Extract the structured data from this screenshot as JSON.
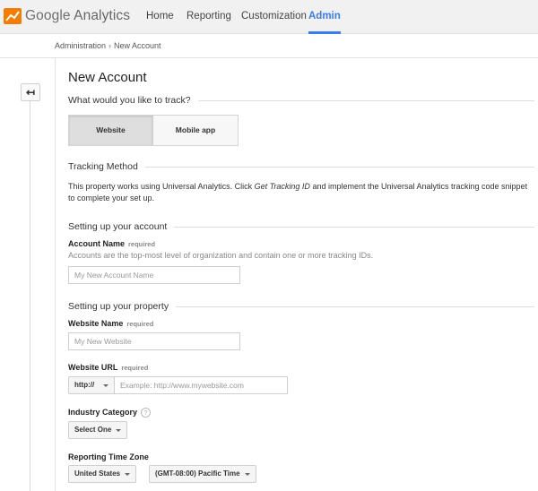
{
  "app": {
    "logo_google": "Google",
    "logo_product": "Analytics"
  },
  "nav": {
    "items": [
      {
        "label": "Home"
      },
      {
        "label": "Reporting"
      },
      {
        "label": "Customization"
      },
      {
        "label": "Admin",
        "active": true
      }
    ]
  },
  "breadcrumb": {
    "items": [
      "Administration",
      "New Account"
    ],
    "separator": "›"
  },
  "back_button": {
    "glyph": "↤",
    "icon": "back-arrow-icon"
  },
  "page": {
    "title": "New Account",
    "track_question": "What would you like to track?",
    "track_options": [
      {
        "label": "Website",
        "selected": true
      },
      {
        "label": "Mobile app",
        "selected": false
      }
    ],
    "tracking_method": {
      "heading": "Tracking Method",
      "text_before": "This property works using Universal Analytics. Click ",
      "text_emphasis": "Get Tracking ID",
      "text_after": " and implement the Universal Analytics tracking code snippet to complete your set up."
    },
    "account_section": {
      "heading": "Setting up your account",
      "account_name_label": "Account Name",
      "required_label": "required",
      "account_name_hint": "Accounts are the top-most level of organization and contain one or more tracking IDs.",
      "account_name_placeholder": "My New Account Name",
      "account_name_value": ""
    },
    "property_section": {
      "heading": "Setting up your property",
      "website_name_label": "Website Name",
      "website_name_placeholder": "My New Website",
      "website_url_label": "Website URL",
      "protocol_value": "http://",
      "website_url_placeholder": "Example: http://www.mywebsite.com",
      "industry_label": "Industry Category",
      "industry_help": "?",
      "industry_value": "Select One",
      "timezone_label": "Reporting Time Zone",
      "country_value": "United States",
      "timezone_value": "(GMT-08:00) Pacific Time"
    }
  },
  "colors": {
    "accent": "#3b7cf0",
    "topbar_bg": "#f1f1f1",
    "logo_orange": "#f57c00"
  }
}
